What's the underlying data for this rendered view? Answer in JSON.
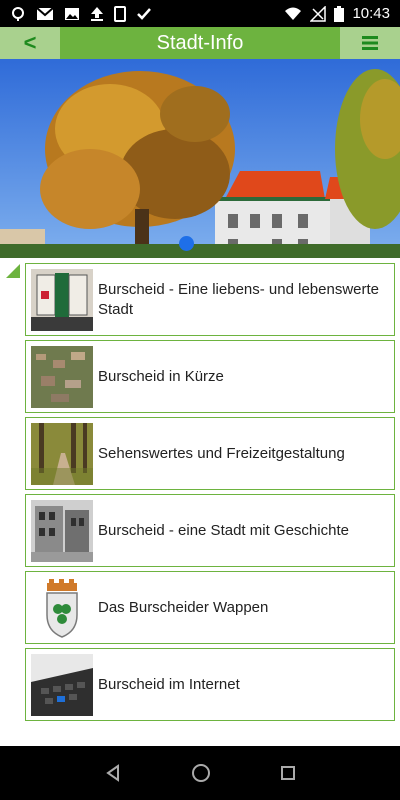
{
  "status_bar": {
    "time": "10:43",
    "icons": [
      "location-icon",
      "mail-icon",
      "image-icon",
      "upload-icon",
      "screenshot-icon",
      "check-icon"
    ],
    "system_icons": [
      "wifi-icon",
      "no-signal-icon",
      "battery-icon"
    ]
  },
  "header": {
    "back_label": "<",
    "title": "Stadt-Info",
    "menu_label": "≡"
  },
  "list": {
    "items": [
      {
        "label": "Burscheid - Eine liebens- und lebenswerte Stadt",
        "thumb": "window-shutters-photo"
      },
      {
        "label": "Burscheid in Kürze",
        "thumb": "aerial-town-photo"
      },
      {
        "label": "Sehenswertes und Freizeitgestaltung",
        "thumb": "forest-path-photo"
      },
      {
        "label": "Burscheid - eine Stadt mit Geschichte",
        "thumb": "historic-street-photo"
      },
      {
        "label": "Das Burscheider Wappen",
        "thumb": "coat-of-arms"
      },
      {
        "label": "Burscheid im Internet",
        "thumb": "keyboard-photo"
      }
    ]
  },
  "colors": {
    "accent": "#6db33f",
    "accent_light": "#a9d18e",
    "header_icon": "#1e8a1e",
    "pager_dot": "#1e6fe8"
  }
}
